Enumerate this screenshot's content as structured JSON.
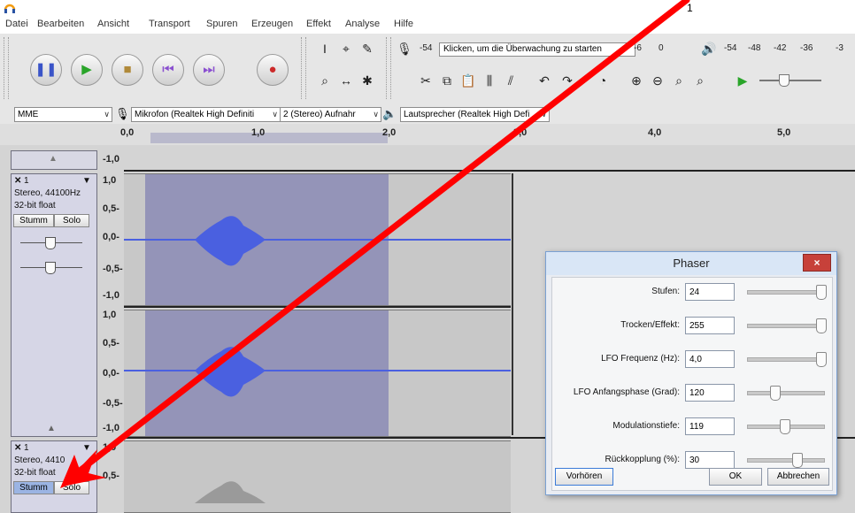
{
  "window": {
    "title_number": "1"
  },
  "menu": [
    "Datei",
    "Bearbeiten",
    "Ansicht",
    "Transport",
    "Spuren",
    "Erzeugen",
    "Effekt",
    "Analyse",
    "Hilfe"
  ],
  "meter": {
    "monitor_box": "Klicken, um die Überwachung zu starten",
    "rec_scale": [
      "-54",
      "-6",
      "0"
    ],
    "play_scale": [
      "-54",
      "-48",
      "-42",
      "-36",
      "-3"
    ]
  },
  "devices": {
    "host": "MME",
    "mic": "Mikrofon (Realtek High Definiti",
    "channels": "2 (Stereo) Aufnahr",
    "speaker": "Lautsprecher (Realtek High Defi"
  },
  "ruler": [
    "0,0",
    "1,0",
    "2,0",
    "3,0",
    "4,0",
    "5,0"
  ],
  "tracks": [
    {
      "name": "1",
      "info1": "Stereo, 44100Hz",
      "info2": "32-bit float",
      "mute": "Stumm",
      "solo": "Solo"
    },
    {
      "name": "1",
      "info1": "Stereo, 4410",
      "info2": "32-bit float",
      "mute": "Stumm",
      "solo": "Solo"
    }
  ],
  "vscale": [
    "-1,0",
    "1,0",
    "0,5-",
    "0,0-",
    "-0,5-",
    "-1,0"
  ],
  "dialog": {
    "title": "Phaser",
    "close": "×",
    "params": [
      {
        "label": "Stufen:",
        "value": "24",
        "slider": 1.0
      },
      {
        "label": "Trocken/Effekt:",
        "value": "255",
        "slider": 1.0
      },
      {
        "label": "LFO Frequenz (Hz):",
        "value": "4,0",
        "slider": 1.0
      },
      {
        "label": "LFO Anfangsphase (Grad):",
        "value": "120",
        "slider": 0.33
      },
      {
        "label": "Modulationstiefe:",
        "value": "119",
        "slider": 0.47
      },
      {
        "label": "Rückkopplung (%):",
        "value": "30",
        "slider": 0.65
      }
    ],
    "preview": "Vorhören",
    "ok": "OK",
    "cancel": "Abbrechen"
  },
  "colors": {
    "accent": "#4a60e0",
    "selection": "#9494b8",
    "arrow": "#ff0000"
  }
}
